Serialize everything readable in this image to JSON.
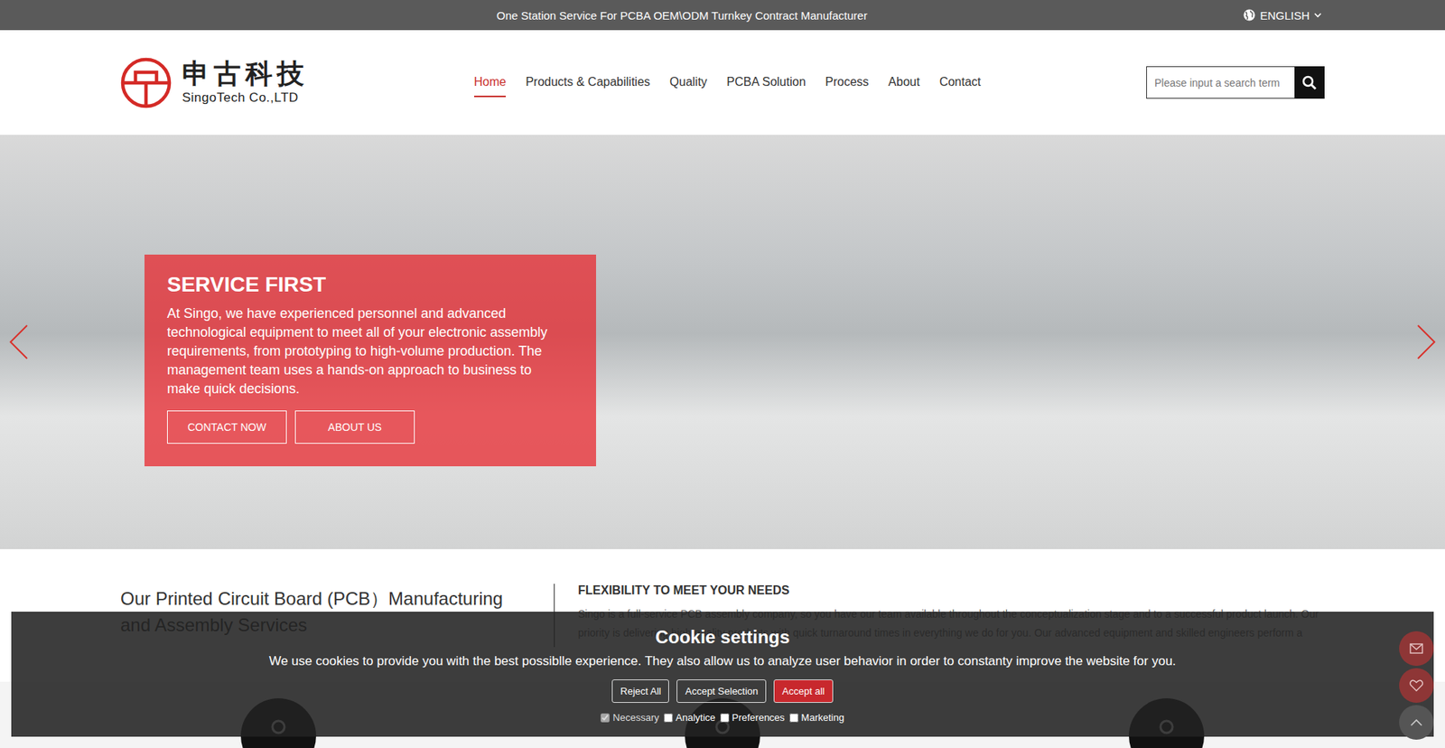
{
  "topbar": {
    "slogan": "One Station Service For PCBA OEM\\ODM Turnkey Contract Manufacturer",
    "language": "ENGLISH"
  },
  "logo": {
    "chinese": "申古科技",
    "english": "SingoTech Co.,LTD"
  },
  "nav": [
    {
      "label": "Home",
      "selected": true
    },
    {
      "label": "Products & Capabilities",
      "selected": false
    },
    {
      "label": "Quality",
      "selected": false
    },
    {
      "label": "PCBA Solution",
      "selected": false
    },
    {
      "label": "Process",
      "selected": false
    },
    {
      "label": "About",
      "selected": false
    },
    {
      "label": "Contact",
      "selected": false
    }
  ],
  "search": {
    "placeholder": "Please input a search term"
  },
  "hero": {
    "title": "SERVICE FIRST",
    "text": "At Singo, we have experienced personnel and advanced technological equipment to meet all of your electronic assembly requirements, from prototyping to high-volume production. The management team uses a hands-on approach to business to make quick decisions.",
    "buttons": [
      "CONTACT NOW",
      "ABOUT US"
    ]
  },
  "intro": {
    "heading": "Our Printed Circuit Board (PCB）Manufacturing and Assembly Services",
    "title": "FLEXIBILITY TO MEET YOUR NEEDS",
    "text": "Singo is a full-service PCB assembly company, so you have our team available throughout the conceptualization stage and to a successful product launch. Our priority is delivering high-quality products with quick turnaround times in everything we do for you. Our advanced equipment and skilled engineers perform a"
  },
  "cookie": {
    "title": "Cookie settings",
    "text": "We use cookies to provide you with the best possiblle experience. They also allow us to analyze user behavior in order to constanty improve the website for you.",
    "buttons": [
      {
        "label": "Reject All",
        "kind": "outline"
      },
      {
        "label": "Accept Selection",
        "kind": "outline"
      },
      {
        "label": "Accept all",
        "kind": "filled"
      }
    ],
    "options": [
      {
        "label": "Necessary",
        "checked": true,
        "disabled": true
      },
      {
        "label": "Analytice",
        "checked": false,
        "disabled": false
      },
      {
        "label": "Preferences",
        "checked": false,
        "disabled": false
      },
      {
        "label": "Marketing",
        "checked": false,
        "disabled": false
      }
    ]
  }
}
